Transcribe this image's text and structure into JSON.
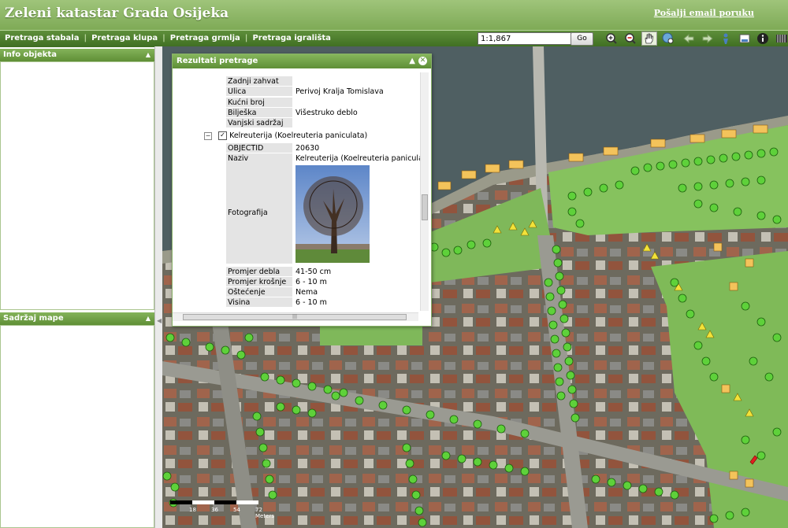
{
  "header": {
    "title": "Zeleni katastar Grada Osijeka",
    "email_link": "Pošalji email poruku"
  },
  "toolbar": {
    "nav": [
      "Pretraga stabala",
      "Pretraga klupa",
      "Pretraga grmlja",
      "Pretraga igrališta"
    ],
    "scale_value": "1:1,867",
    "go_label": "Go",
    "tools": [
      "zoom-in-icon",
      "zoom-out-icon",
      "pan-hand-icon",
      "globe-zoom-icon",
      "back-arrow-icon",
      "forward-arrow-icon",
      "measure-icon",
      "print-icon",
      "info-icon",
      "grid-icon"
    ]
  },
  "left": {
    "info_title": "Info objekta",
    "content_title": "Sadržaj mape"
  },
  "popup": {
    "title": "Rezultati pretrage",
    "top_rows": [
      {
        "k": "Zadnji zahvat",
        "v": ""
      },
      {
        "k": "Ulica",
        "v": "Perivoj Kralja Tomislava"
      },
      {
        "k": "Kućni broj",
        "v": ""
      },
      {
        "k": "Bilješka",
        "v": "Višestruko deblo"
      },
      {
        "k": "Vanjski sadržaj",
        "v": ""
      }
    ],
    "node_label": "Kelreuterija (Koelreuteria paniculata)",
    "rows": [
      {
        "k": "OBJECTID",
        "v": "20630"
      },
      {
        "k": "Naziv",
        "v": "Kelreuterija (Koelreuteria paniculata)"
      }
    ],
    "photo_label": "Fotografija",
    "bottom_rows": [
      {
        "k": "Promjer debla",
        "v": "41-50 cm"
      },
      {
        "k": "Promjer krošnje",
        "v": "6 - 10 m"
      },
      {
        "k": "Oštećenje krošnje",
        "v": "Nema"
      },
      {
        "k": "Visina",
        "v": "6 - 10 m"
      }
    ]
  },
  "map": {
    "scale_labels": [
      "18",
      "36",
      "54",
      "72 Meters"
    ]
  }
}
